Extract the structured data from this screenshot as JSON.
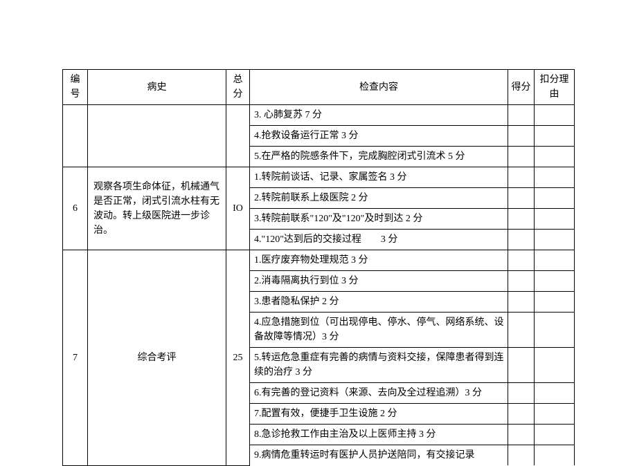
{
  "headers": {
    "num": "编号",
    "history": "病史",
    "total": "总分",
    "content": "检查内容",
    "score": "得分",
    "reason": "扣分理由"
  },
  "prev_group": {
    "items": [
      "3. 心肺复苏 7 分",
      "4.抢救设备运行正常 3 分",
      "5.在严格的院感条件下，完成胸腔闭式引流术 5 分"
    ]
  },
  "group6": {
    "num": "6",
    "history": "观察各项生命体征，机械通气是否正常，闭式引流水柱有无波动。转上级医院进一步诊治。",
    "total": "IO",
    "items": [
      "1.转院前谈话、记录、家属签名 3 分",
      "2.转院前联系上级医院 2 分",
      "3.转院前联系\"120\"及\"120\"及时到达 2 分",
      "4.\"120\"达到后的交接过程  3 分"
    ]
  },
  "group7": {
    "num": "7",
    "history": "综合考评",
    "total": "25",
    "items": [
      "1.医疗废弃物处理规范 3 分",
      "2.消毒隔离执行到位 3 分",
      "3.患者隐私保护 2 分",
      "4.应急措施到位（可出现停电、停水、停气、网络系统、设备故障等情况）3 分",
      "5.转运危急重症有完善的病情与资料交接，保障患者得到连续的治疗 3 分",
      "6.有完善的登记资料（来源、去向及全过程追溯）3 分",
      "7.配置有效，便捷手卫生设施 2 分",
      "8.急诊抢救工作由主治及以上医师主持 3 分",
      "9.病情危重转运时有医护人员护送陪同，有交接记录"
    ]
  }
}
